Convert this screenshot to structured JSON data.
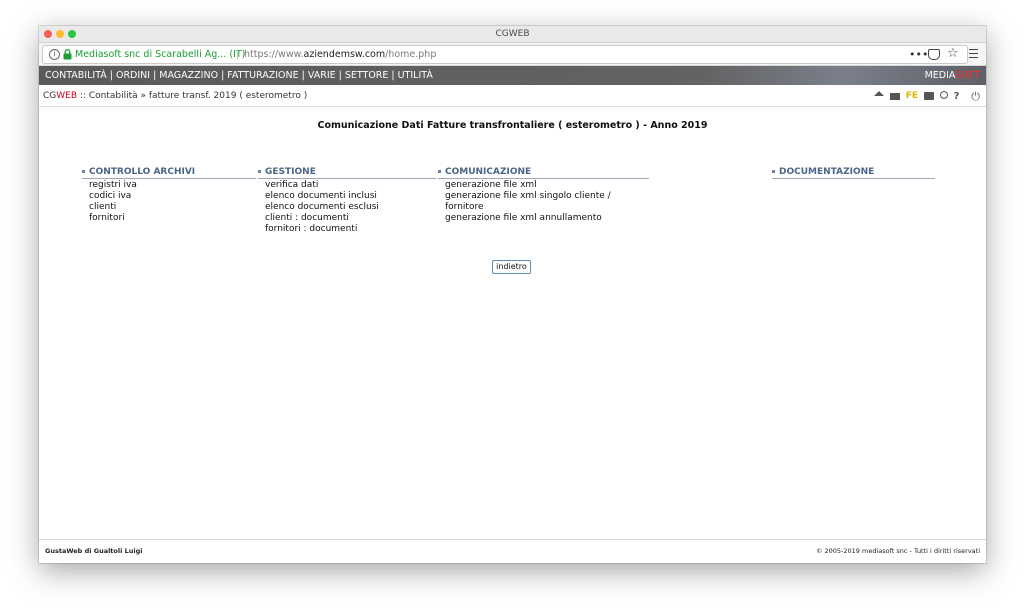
{
  "window": {
    "title": "CGWEB"
  },
  "browser": {
    "site_identity": "Mediasoft snc di Scarabelli Ag... (IT)",
    "url_prefix": "https://www.",
    "url_domain": "aziendemsw.com",
    "url_path": "/home.php",
    "more_glyph": "•••",
    "star_glyph": "☆"
  },
  "menubar": {
    "items": [
      "CONTABILITÀ",
      "ORDINI",
      "MAGAZZINO",
      "FATTURAZIONE",
      "VARIE",
      "SETTORE",
      "UTILITÀ"
    ],
    "brand_part1": "MEDIA",
    "brand_part2": "SOFT",
    "separator": "|"
  },
  "breadcrumb": {
    "app_cg": "CG",
    "app_web": "WEB",
    "path": " :: Contabilità » fatture transf. 2019 ( esterometro )"
  },
  "toolbar": {
    "fe_label": "FE",
    "help_glyph": "?",
    "power_glyph": "⏻"
  },
  "main": {
    "heading": "Comunicazione Dati Fatture transfrontaliere ( esterometro ) - Anno 2019",
    "columns": [
      {
        "title": "CONTROLLO ARCHIVI",
        "items": [
          "registri iva",
          "codici iva",
          "clienti",
          "fornitori"
        ]
      },
      {
        "title": "GESTIONE",
        "items": [
          "verifica dati",
          "elenco documenti inclusi",
          "elenco documenti esclusi",
          "clienti : documenti",
          "fornitori : documenti"
        ]
      },
      {
        "title": "COMUNICAZIONE",
        "items": [
          "generazione file xml",
          "generazione file xml singolo cliente / fornitore",
          "generazione file xml annullamento"
        ]
      },
      {
        "title": "DOCUMENTAZIONE",
        "items": []
      }
    ],
    "back_label": "indietro"
  },
  "footer": {
    "left": "GustaWeb di Gualtoli Luigi",
    "right": "© 2005-2019 mediasoft snc - Tutti i diritti riservati"
  }
}
